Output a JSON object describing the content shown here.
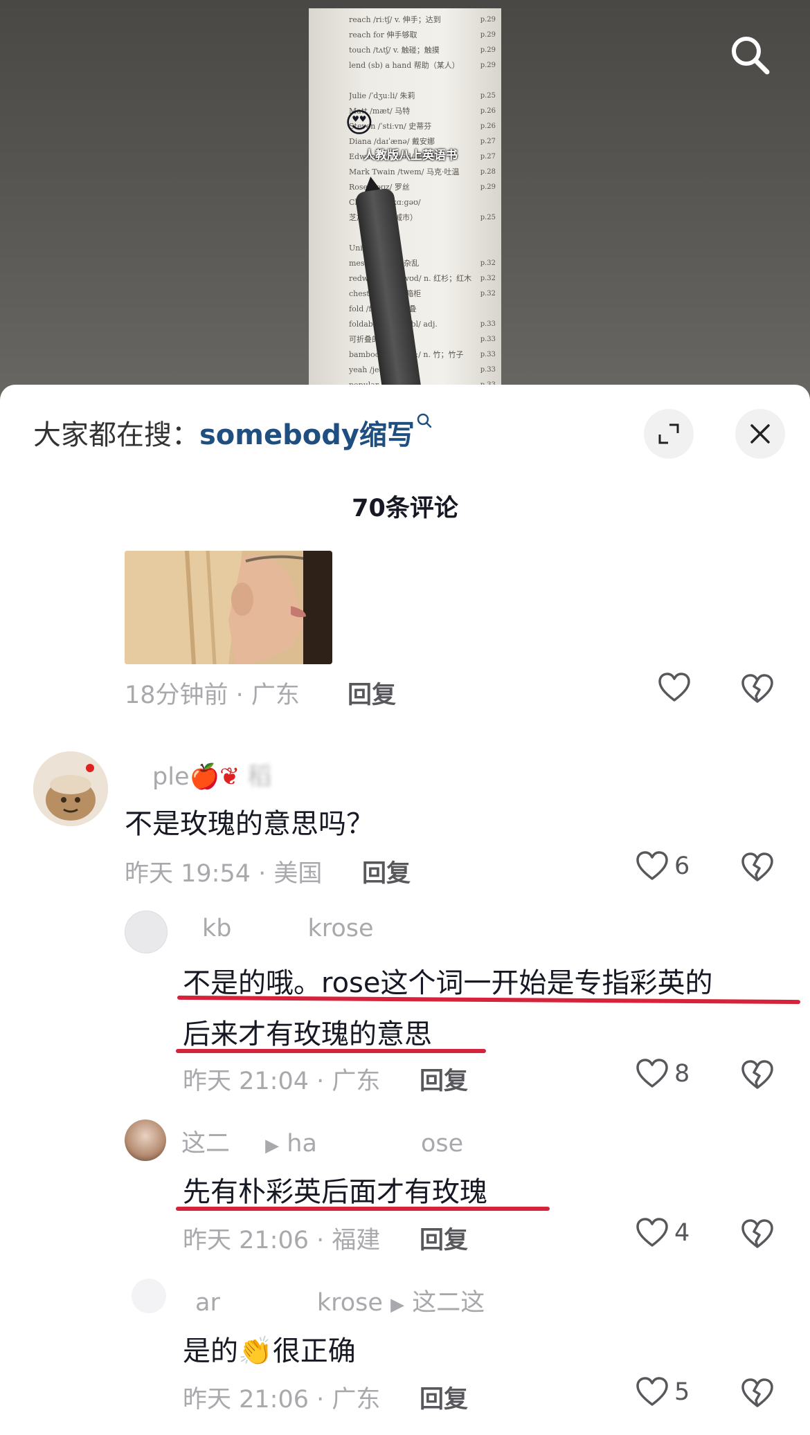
{
  "video": {
    "book_lines_left": [
      "reach /riːtʃ/ v. 伸手；达到",
      "reach for 伸手够取",
      "touch /tʌtʃ/ v. 触碰；触摸",
      "lend (sb) a hand 帮助（某人）",
      "",
      "Julie /ˈdʒuːli/ 朱莉",
      "Matt /mæt/ 马特",
      "Steven /ˈstiːvn/ 史蒂芬",
      "Diana /daɪˈænə/ 戴安娜",
      "Edward /ˈedwəd/ 爱德华",
      "Mark Twain /twem/ 马克·吐温",
      "Rose /rəʊz/ 罗丝",
      "Chicago /ʃɪˈkɑːɡəʊ/",
      "芝加哥（美国城市）",
      "",
      "Unit 4",
      "mess /mes/ n. 杂乱",
      "redwood /ˈredwʊd/ n. 红杉；红木",
      "chest /tʃest/ n. 箱柜",
      "fold /fəʊld/ v. 折叠",
      "foldable /ˈfəʊldəbl/ adj.",
      "可折叠的",
      "bamboo /bæmˈbuː/ n. 竹；竹子",
      "yeah /jeə/",
      "popular"
    ],
    "book_pages": [
      "p.29",
      "p.29",
      "p.29",
      "p.29",
      "",
      "p.25",
      "p.26",
      "p.26",
      "p.27",
      "p.27",
      "p.28",
      "p.29",
      "",
      "p.25",
      "",
      "",
      "p.32",
      "p.32",
      "p.32",
      "",
      "p.33",
      "p.33",
      "p.33",
      "p.33",
      "p.33"
    ],
    "overlay_text": "人教版八上英语书",
    "search_icon": "search-icon"
  },
  "header": {
    "hot_label": "大家都在搜：",
    "hot_keyword": "somebody缩写",
    "expand_icon": "expand-icon",
    "close_icon": "close-icon"
  },
  "comment_count": "70条评论",
  "comments": [
    {
      "meta": "18分钟前 · 广东",
      "reply": "回复",
      "likes": ""
    },
    {
      "username": "ple🍎",
      "username_suffix": "稻",
      "text": "不是玫瑰的意思吗？",
      "meta": "昨天 19:54 · 美国",
      "reply": "回复",
      "likes": "6"
    },
    {
      "username": "kb",
      "username_suffix": "krose",
      "text_line1": "不是的哦。rose这个词一开始是专指彩英的",
      "text_line2": "后来才有玫瑰的意思",
      "meta": "昨天 21:04 · 广东",
      "reply": "回复",
      "likes": "8"
    },
    {
      "username": "这二",
      "reply_to": "ha",
      "reply_to_suffix": "ose",
      "text": "先有朴彩英后面才有玫瑰",
      "meta": "昨天 21:06 · 福建",
      "reply": "回复",
      "likes": "4"
    },
    {
      "username": "ar",
      "username_suffix": "krose",
      "reply_to": "这二这",
      "text_before": "是的",
      "text_emoji": "👏",
      "text_after": "很正确",
      "meta": "昨天 21:06 · 广东",
      "reply": "回复",
      "likes": "5"
    }
  ],
  "colors": {
    "keyword": "#1f4f80",
    "underline": "#d4233a",
    "meta": "#a9a9ad"
  }
}
